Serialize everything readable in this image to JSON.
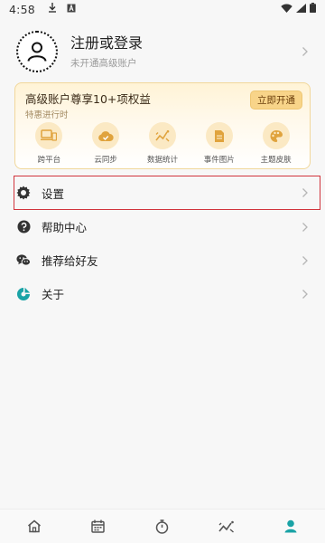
{
  "status_bar": {
    "time": "4:58",
    "icons": [
      "download-icon",
      "app-a-icon",
      "wifi-icon",
      "signal-icon",
      "battery-icon"
    ]
  },
  "profile": {
    "name": "注册或登录",
    "subtitle": "未开通高级账户"
  },
  "premium": {
    "title": "高级账户尊享10+项权益",
    "subtitle": "特惠进行时",
    "button_label": "立即开通",
    "features": [
      {
        "icon": "multi-platform-icon",
        "label": "跨平台"
      },
      {
        "icon": "cloud-sync-icon",
        "label": "云同步"
      },
      {
        "icon": "chart-stats-icon",
        "label": "数据统计"
      },
      {
        "icon": "event-image-icon",
        "label": "事件图片"
      },
      {
        "icon": "palette-icon",
        "label": "主题皮肤"
      }
    ]
  },
  "menu": [
    {
      "icon": "gear-icon",
      "label": "设置"
    },
    {
      "icon": "help-icon",
      "label": "帮助中心"
    },
    {
      "icon": "wechat-icon",
      "label": "推荐给好友"
    },
    {
      "icon": "app-logo-icon",
      "label": "关于"
    }
  ],
  "bottom_nav": {
    "items": [
      "home-icon",
      "calendar-icon",
      "timer-icon",
      "stats-icon",
      "profile-icon"
    ],
    "active": "profile-icon"
  },
  "colors": {
    "accent": "#1aa3a6",
    "premium_border": "#f1d79b",
    "premium_button": "#f8d489",
    "highlight": "#d1343c"
  }
}
